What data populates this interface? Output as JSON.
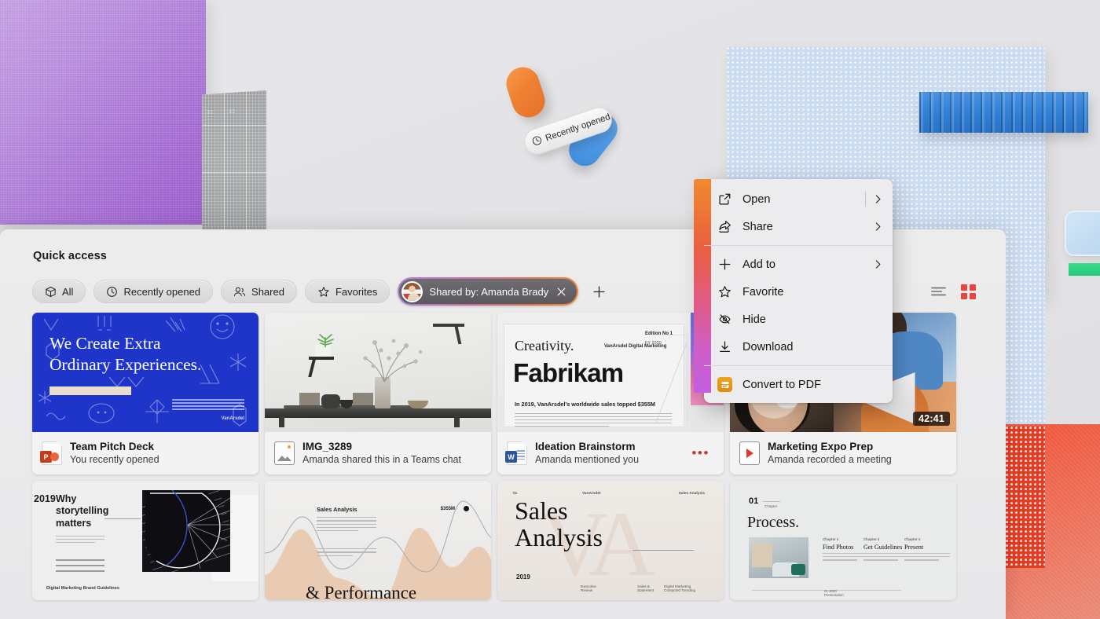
{
  "panel": {
    "title": "Quick access",
    "filters": [
      {
        "label": "All",
        "icon": "cube-icon"
      },
      {
        "label": "Recently opened",
        "icon": "clock-icon"
      },
      {
        "label": "Shared",
        "icon": "people-icon"
      },
      {
        "label": "Favorites",
        "icon": "star-icon"
      }
    ],
    "person_chip": {
      "label": "Shared by: Amanda Brady",
      "close_icon": "close-icon",
      "avatar": "avatar"
    },
    "add_filter_label": "+",
    "view_toggles": [
      {
        "name": "list-view",
        "active": false
      },
      {
        "name": "grid-view",
        "active": true
      }
    ]
  },
  "files": {
    "row1": [
      {
        "name": "Team Pitch Deck",
        "subtitle": "You recently opened",
        "icon": "powerpoint-icon",
        "icon_letter": "P",
        "icon_color": "#c43e1c",
        "thumb": {
          "kind": "blue-slide",
          "headline": "We Create Extra\nOrdinary Experiences.",
          "watermark": "VanArsdel"
        }
      },
      {
        "name": "IMG_3289",
        "subtitle": "Amanda shared this in a Teams chat",
        "icon": "image-icon",
        "thumb": {
          "kind": "photo-interior"
        }
      },
      {
        "name": "Ideation Brainstorm",
        "subtitle": "Amanda mentioned you",
        "icon": "word-icon",
        "icon_letter": "W",
        "icon_color": "#2b579a",
        "overflow_icon": "ellipsis-icon",
        "thumb": {
          "kind": "fabrikam",
          "eyebrow": "Creativity.",
          "brand": "Fabrikam",
          "tagline": "In 2019, VanArsdel's worldwide sales topped $355M",
          "edition": "Edition No 1",
          "fiscal_year": "FY 2020",
          "byline": "VanArsdel  Digital Marketing"
        }
      },
      {
        "name": "Marketing Expo Prep",
        "subtitle": "Amanda recorded a meeting",
        "icon": "video-icon",
        "thumb": {
          "kind": "video",
          "duration": "42:41"
        }
      }
    ],
    "row2": [
      {
        "thumb": {
          "kind": "storytelling",
          "year": "2019",
          "headline": "Why\nstorytelling\nmatters",
          "footer": "Digital Marketing  Brand Guidelines"
        }
      },
      {
        "thumb": {
          "kind": "sales-performance",
          "title": "Sales Analysis",
          "data_label": "$355M",
          "headline": "& Performance"
        }
      },
      {
        "thumb": {
          "kind": "sales-analysis",
          "title": "Sales\nAnalysis",
          "year": "2019",
          "header_left": "01",
          "header_mid": "VanArsdel",
          "header_right": "Sales Analysis",
          "footers": [
            "Executive\nReview",
            "Sales &\nStatement",
            "Digital Marketing\nContacted  Trending"
          ]
        }
      },
      {
        "thumb": {
          "kind": "process",
          "number": "01",
          "number_sub": "Chapter",
          "title": "Process.",
          "columns": [
            {
              "eyebrow": "Chapter 1",
              "title": "Find Photos"
            },
            {
              "eyebrow": "Chapter 2",
              "title": "Get Guidelines"
            },
            {
              "eyebrow": "Chapter 3",
              "title": "Present"
            }
          ],
          "footer": "01 2020\nPresentation"
        }
      }
    ]
  },
  "context_menu": {
    "items": [
      {
        "label": "Open",
        "icon": "open-external-icon",
        "has_submenu": true,
        "has_divider_before_arrow": true
      },
      {
        "label": "Share",
        "icon": "share-icon",
        "has_submenu": true
      },
      {
        "separator_after": true
      },
      {
        "label": "Add to",
        "icon": "plus-icon",
        "has_submenu": true
      },
      {
        "label": "Favorite",
        "icon": "star-icon",
        "has_submenu": false
      },
      {
        "label": "Hide",
        "icon": "eye-off-icon",
        "has_submenu": false
      },
      {
        "label": "Download",
        "icon": "download-icon",
        "has_submenu": false
      },
      {
        "separator_after": true
      },
      {
        "label": "Convert to PDF",
        "icon": "pdf-icon",
        "has_submenu": false
      }
    ]
  },
  "decor": {
    "floating_chip_label": "Recently opened",
    "floating_chip_icon": "clock-icon",
    "tower_labels": [
      "31",
      "32"
    ]
  },
  "colors": {
    "accent_gradient_start": "#f08a2e",
    "accent_gradient_end": "#c35ee0",
    "grid_view_active": "#e8453c",
    "slide_blue": "#1f35c9",
    "purple_panel": "#a86fd6",
    "red_panel": "#ef5338",
    "dot_panel_blue": "#cbdcf0",
    "pdf_badge": "#f0a31e"
  }
}
